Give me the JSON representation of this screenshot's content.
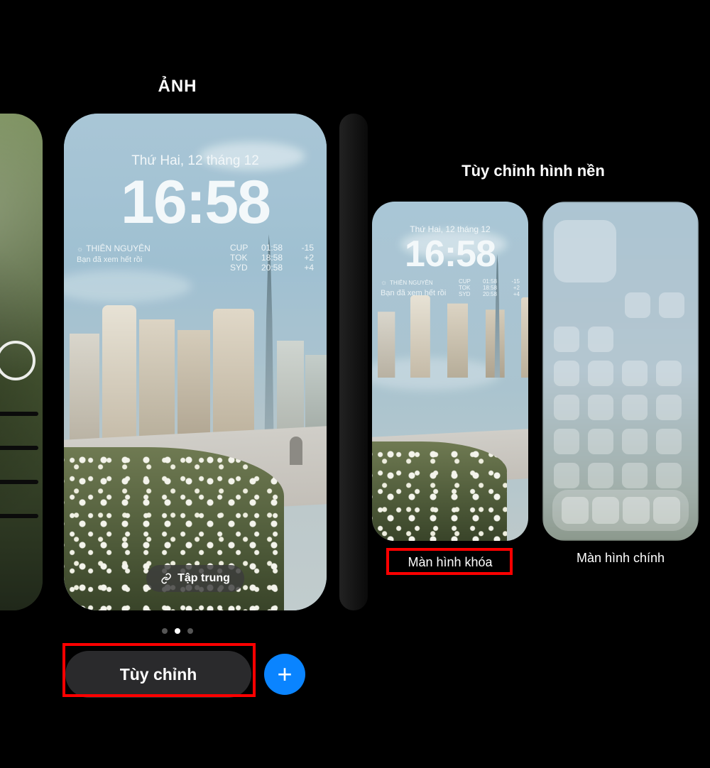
{
  "left": {
    "title": "ẢNH",
    "lockscreen": {
      "date": "Thứ Hai, 12 tháng 12",
      "time": "16:58",
      "widget_left_line1": "THIÊN NGUYÊN",
      "widget_left_line2": "Bạn đã xem hết rồi",
      "clocks": [
        {
          "city": "CUP",
          "time": "01:58",
          "offset": "-15"
        },
        {
          "city": "TOK",
          "time": "18:58",
          "offset": "+2"
        },
        {
          "city": "SYD",
          "time": "20:58",
          "offset": "+4"
        }
      ],
      "focus_label": "Tập trung"
    },
    "customize_label": "Tùy chỉnh",
    "add_label": "+"
  },
  "right": {
    "title": "Tùy chỉnh hình nền",
    "lockscreen": {
      "date": "Thứ Hai, 12 tháng 12",
      "time": "16:58",
      "widget_left_line1": "THIÊN NGUYÊN",
      "widget_left_line2": "Bạn đã xem hết rồi",
      "clocks": [
        {
          "city": "CUP",
          "time": "01:58",
          "offset": "-15"
        },
        {
          "city": "TOK",
          "time": "18:58",
          "offset": "+2"
        },
        {
          "city": "SYD",
          "time": "20:58",
          "offset": "+4"
        }
      ]
    },
    "lock_label": "Màn hình khóa",
    "home_label": "Màn hình chính"
  }
}
